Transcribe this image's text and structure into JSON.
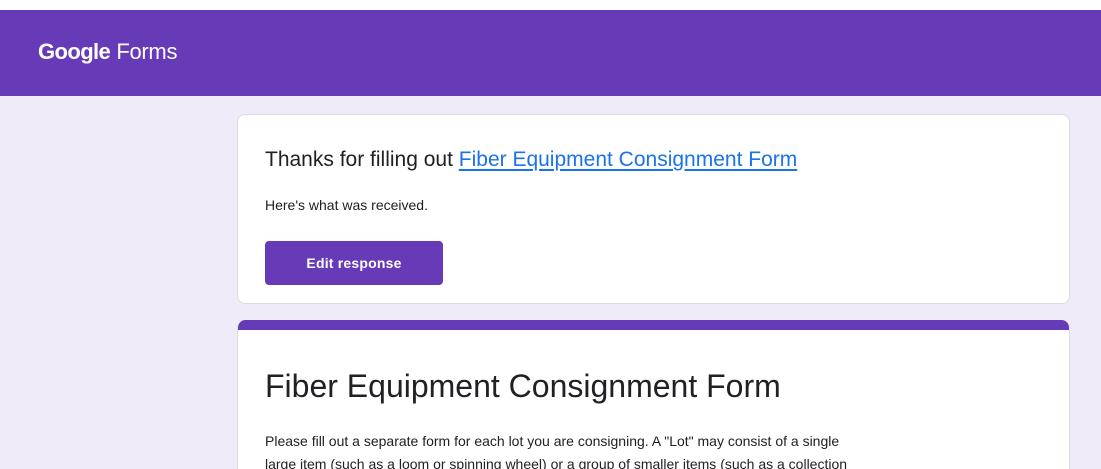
{
  "app": {
    "brand_google": "Google",
    "brand_forms": "Forms"
  },
  "confirmation": {
    "thanks_prefix": "Thanks for filling out ",
    "form_link": "Fiber Equipment Consignment Form",
    "received_text": "Here's what was received.",
    "edit_button": "Edit response"
  },
  "form": {
    "title": "Fiber Equipment Consignment Form",
    "description_lines": [
      "Please fill out a separate form for each lot you are consigning. A \"Lot\" may consist of a single",
      "large item (such as a loom or spinning wheel) or a group of smaller items (such as a collection"
    ]
  },
  "colors": {
    "brand": "#673ab7",
    "background": "#f0ebf8",
    "link": "#1a73e8"
  }
}
